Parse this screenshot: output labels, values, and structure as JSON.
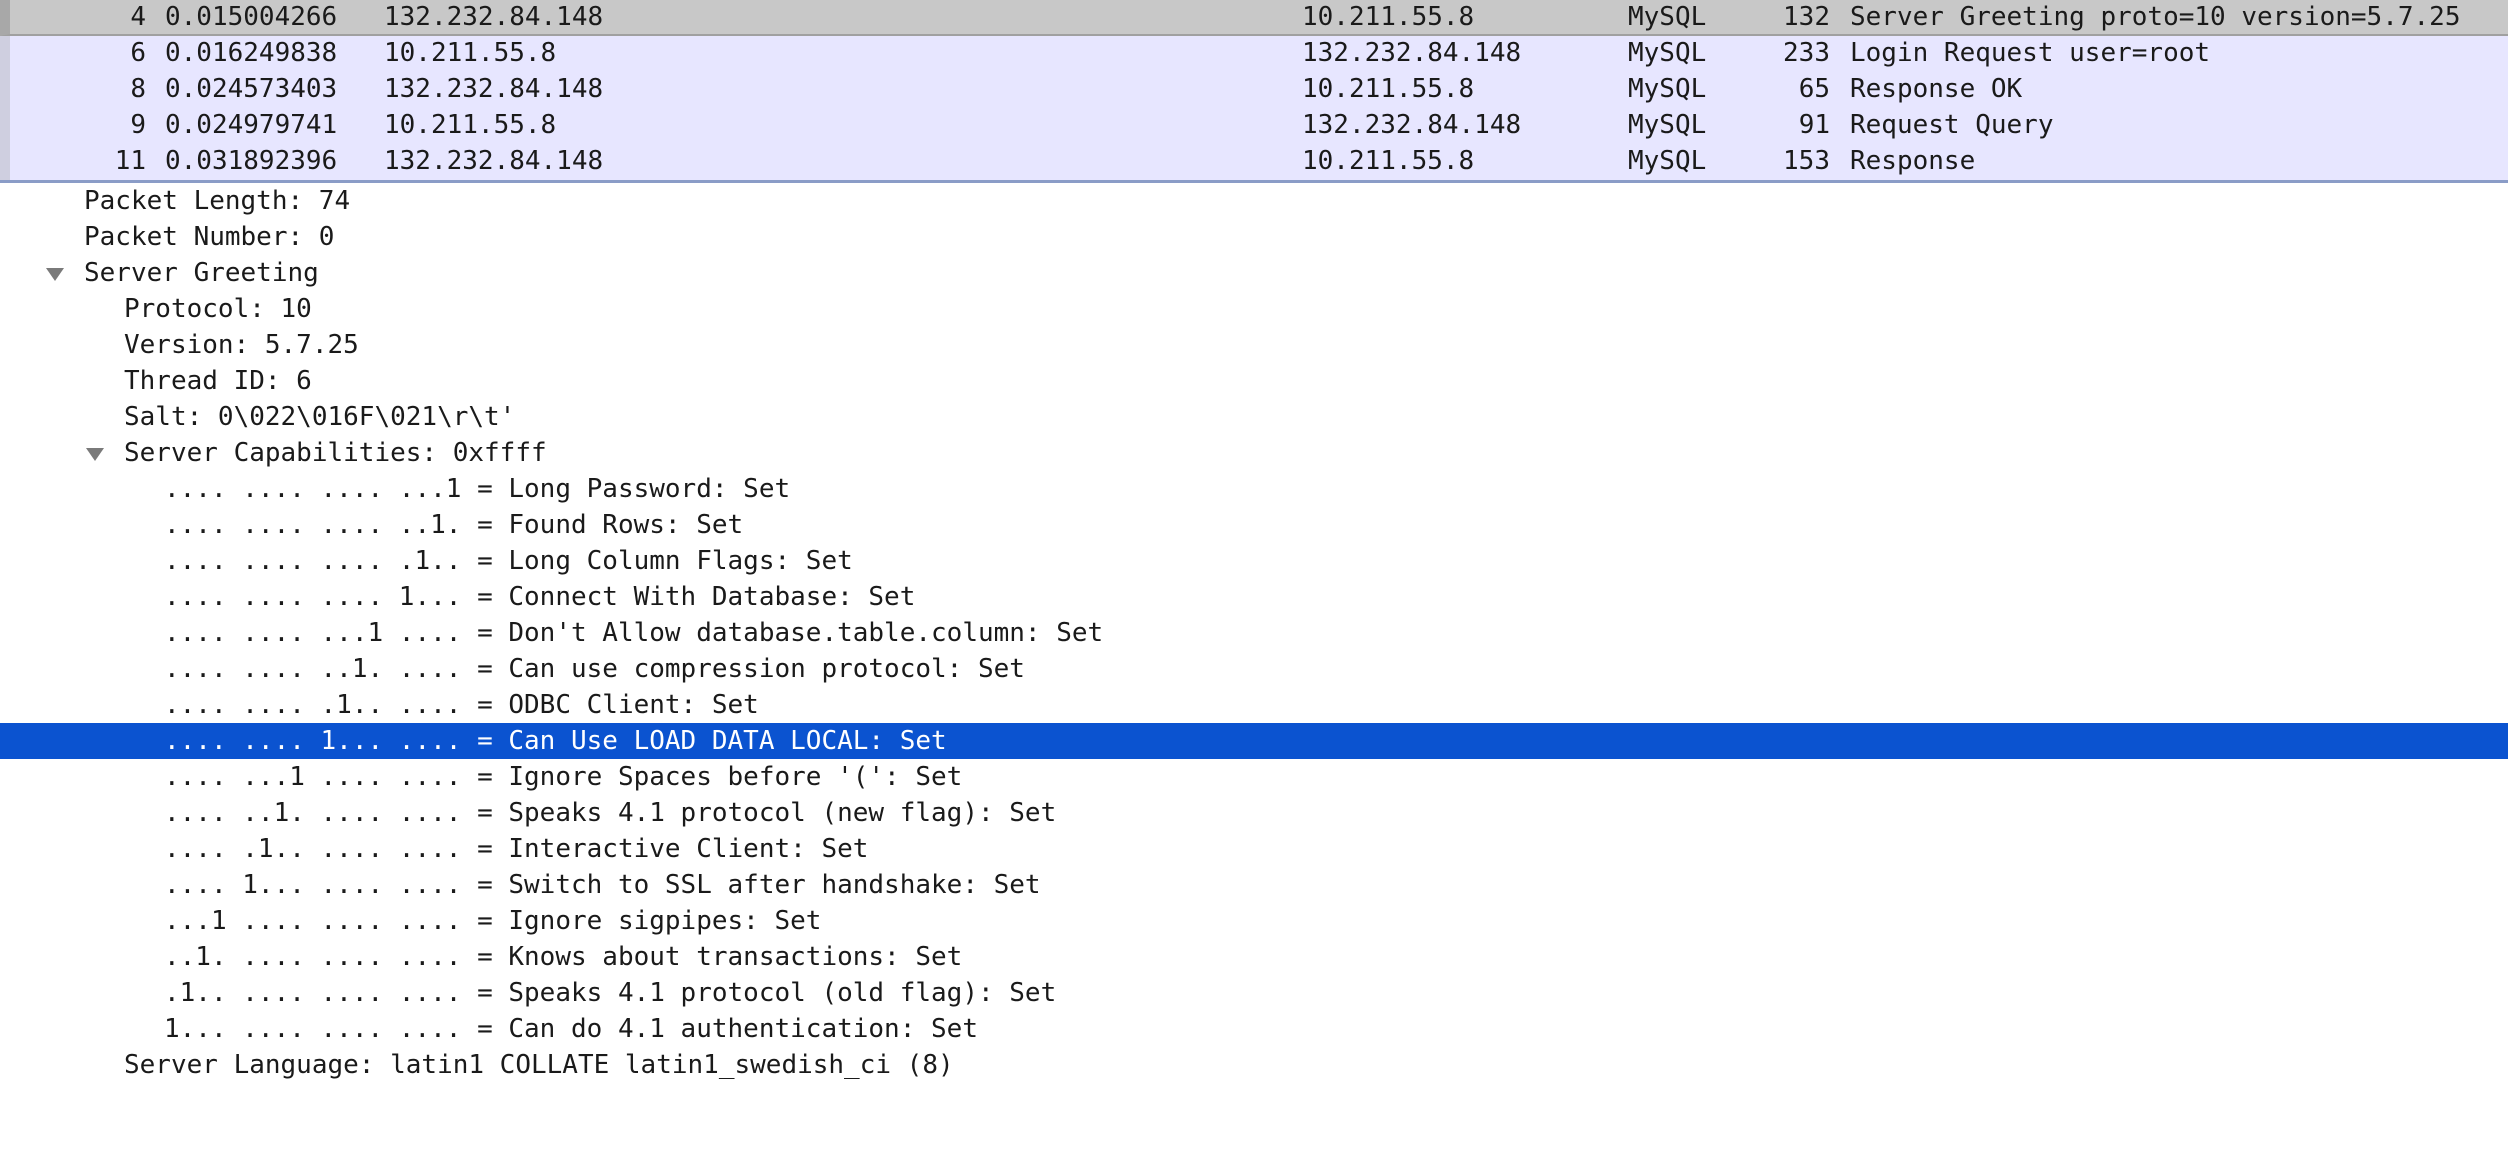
{
  "packets": [
    {
      "no": "4",
      "time": "0.015004266",
      "source": "132.232.84.148",
      "destination": "10.211.55.8",
      "protocol": "MySQL",
      "length": "132",
      "info": "Server Greeting proto=10 version=5.7.25"
    },
    {
      "no": "6",
      "time": "0.016249838",
      "source": "10.211.55.8",
      "destination": "132.232.84.148",
      "protocol": "MySQL",
      "length": "233",
      "info": "Login Request user=root"
    },
    {
      "no": "8",
      "time": "0.024573403",
      "source": "132.232.84.148",
      "destination": "10.211.55.8",
      "protocol": "MySQL",
      "length": "65",
      "info": "Response OK"
    },
    {
      "no": "9",
      "time": "0.024979741",
      "source": "10.211.55.8",
      "destination": "132.232.84.148",
      "protocol": "MySQL",
      "length": "91",
      "info": "Request Query"
    },
    {
      "no": "11",
      "time": "0.031892396",
      "source": "132.232.84.148",
      "destination": "10.211.55.8",
      "protocol": "MySQL",
      "length": "153",
      "info": "Response"
    }
  ],
  "details": {
    "packet_length": "Packet Length: 74",
    "packet_number": "Packet Number: 0",
    "server_greeting": "Server Greeting",
    "protocol": "Protocol: 10",
    "version": "Version: 5.7.25",
    "thread_id": "Thread ID: 6",
    "salt": "Salt: 0\\022\\016F\\021\\r\\t'",
    "server_capabilities": "Server Capabilities: 0xffff",
    "flags": [
      ".... .... .... ...1 = Long Password: Set",
      ".... .... .... ..1. = Found Rows: Set",
      ".... .... .... .1.. = Long Column Flags: Set",
      ".... .... .... 1... = Connect With Database: Set",
      ".... .... ...1 .... = Don't Allow database.table.column: Set",
      ".... .... ..1. .... = Can use compression protocol: Set",
      ".... .... .1.. .... = ODBC Client: Set",
      ".... .... 1... .... = Can Use LOAD DATA LOCAL: Set",
      ".... ...1 .... .... = Ignore Spaces before '(': Set",
      ".... ..1. .... .... = Speaks 4.1 protocol (new flag): Set",
      ".... .1.. .... .... = Interactive Client: Set",
      ".... 1... .... .... = Switch to SSL after handshake: Set",
      "...1 .... .... .... = Ignore sigpipes: Set",
      "..1. .... .... .... = Knows about transactions: Set",
      ".1.. .... .... .... = Speaks 4.1 protocol (old flag): Set",
      "1... .... .... .... = Can do 4.1 authentication: Set"
    ],
    "server_language": "Server Language: latin1 COLLATE latin1_swedish_ci (8)"
  },
  "colors": {
    "selection": "#0b53d0",
    "packet_row_bg": "#e7e6ff",
    "selected_packet_bg": "#c8c8c8"
  },
  "icons": {
    "expand": "disclosure-triangle-expanded-icon"
  }
}
